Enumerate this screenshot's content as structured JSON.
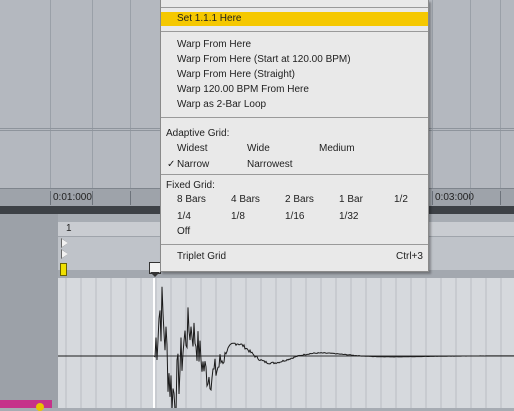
{
  "ruler": {
    "labels": [
      "0:01:000",
      "0:03:000"
    ]
  },
  "clip": {
    "number": "1"
  },
  "menu": {
    "set_here": "Set 1.1.1 Here",
    "warp_from_here": "Warp From Here",
    "warp_from_here_start": "Warp From Here (Start at 120.00 BPM)",
    "warp_from_here_straight": "Warp From Here (Straight)",
    "warp_bpm_from_here": "Warp 120.00 BPM From Here",
    "warp_2bar_loop": "Warp as 2-Bar Loop",
    "adaptive_grid": {
      "heading": "Adaptive Grid:",
      "widest": "Widest",
      "wide": "Wide",
      "medium": "Medium",
      "narrow": "Narrow",
      "narrowest": "Narrowest",
      "check": "✓"
    },
    "fixed_grid": {
      "heading": "Fixed Grid:",
      "options_row1": [
        "8 Bars",
        "4 Bars",
        "2 Bars",
        "1 Bar",
        "1/2"
      ],
      "options_row2": [
        "1/4",
        "1/8",
        "1/16",
        "1/32"
      ],
      "off": "Off"
    },
    "triplet_grid": "Triplet Grid",
    "triplet_shortcut": "Ctrl+3"
  },
  "colors": {
    "highlight": "#f5c800",
    "menu_bg": "#e9e9e9",
    "waveform": "#1a1a1a",
    "clip_tab": "#c6318a"
  }
}
